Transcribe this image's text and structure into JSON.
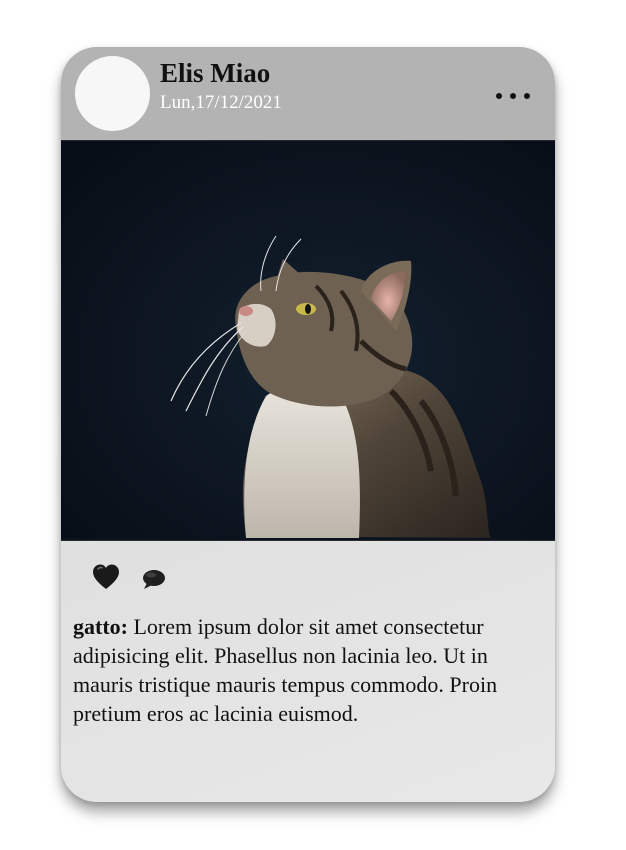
{
  "post": {
    "author": "Elis Miao",
    "date": "Lun,17/12/2021",
    "more_icon": "more-horizontal-icon",
    "image_subject": "cat",
    "like_icon": "heart-icon",
    "comment_icon": "speech-bubble-icon",
    "caption_user": "gatto:",
    "caption_text": " Lorem ipsum dolor sit amet consectetur adipisicing elit. Phasellus non lacinia leo. Ut in mauris tristique mauris tempus commodo. Proin pretium eros ac lacinia euismod."
  },
  "colors": {
    "header_bg": "#b3b3b3",
    "date_text": "#ffffff",
    "photo_bg": "#0b1320"
  }
}
